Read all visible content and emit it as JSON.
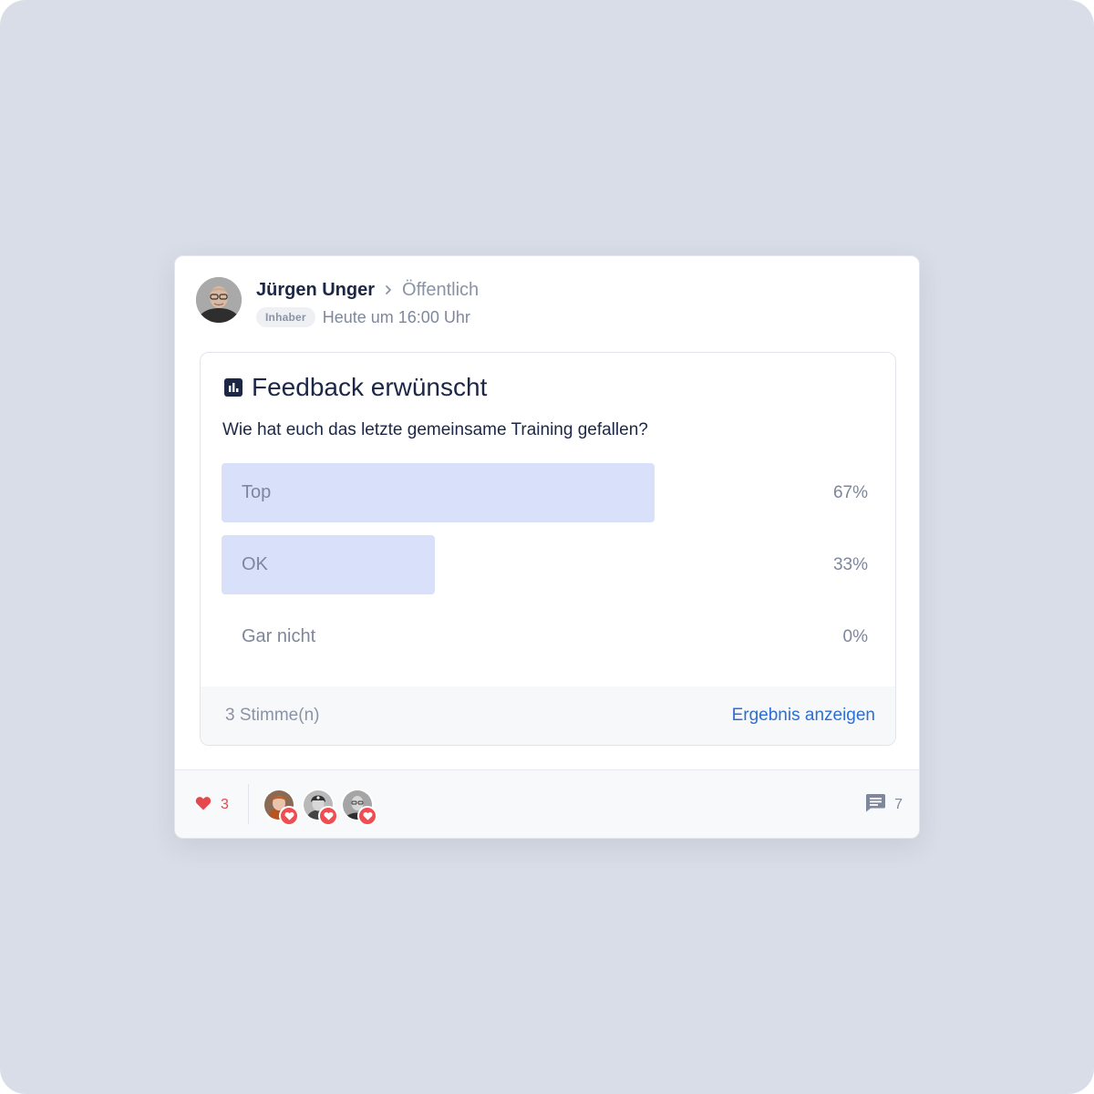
{
  "post": {
    "author": "Jürgen Unger",
    "audience": "Öffentlich",
    "role": "Inhaber",
    "timestamp": "Heute um 16:00 Uhr"
  },
  "poll": {
    "title": "Feedback erwünscht",
    "question": "Wie hat euch das letzte gemeinsame Training gefallen?",
    "options": [
      {
        "label": "Top",
        "percent_text": "67%",
        "share": 0.67
      },
      {
        "label": "OK",
        "percent_text": "33%",
        "share": 0.33
      },
      {
        "label": "Gar nicht",
        "percent_text": "0%",
        "share": 0
      }
    ],
    "votes": "3 Stimme(n)",
    "show_results": "Ergebnis anzeigen"
  },
  "reactions": {
    "like_count": "3",
    "comment_count": "7",
    "reactors": [
      "reactor-1",
      "reactor-2",
      "reactor-3"
    ]
  },
  "icons": {
    "audience_chevron": "chevron-right-icon",
    "poll": "bar-chart-icon",
    "like": "heart-icon",
    "comments": "comment-icon"
  },
  "colors": {
    "accent_link": "#2b6fd6",
    "bar_fill": "#d8e1f9",
    "like": "#e5484d",
    "heading": "#1c2746"
  }
}
